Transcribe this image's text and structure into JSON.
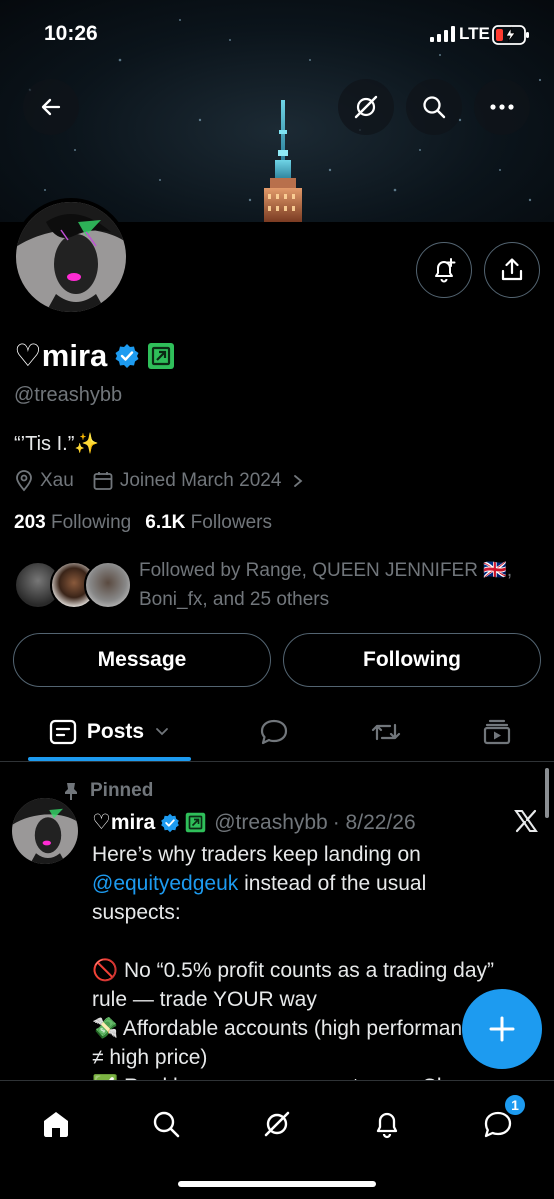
{
  "status": {
    "time": "10:26",
    "network": "LTE"
  },
  "profile": {
    "display_name": "♡mira",
    "handle": "@treashybb",
    "bio": "“’Tis I.”✨",
    "location": "Xau",
    "joined": "Joined March 2024",
    "following_count": "203",
    "following_label": "Following",
    "followers_count": "6.1K",
    "followers_label": "Followers",
    "followed_by_line1": "Followed by Range, QUEEN JENNIFER 🇬🇧,",
    "followed_by_line2": "Boni_fx, and 25 others"
  },
  "actions": {
    "message": "Message",
    "following": "Following"
  },
  "tabs": {
    "posts": "Posts"
  },
  "pinned_post": {
    "pinned_label": "Pinned",
    "author": "♡mira",
    "handle": "@treashybb",
    "date": "· 8/22/26",
    "line1": "Here’s why traders keep landing on",
    "mention": "@equityedgeuk",
    "line2_rest": " instead of the usual",
    "line3": "suspects:",
    "line5": "🚫 No “0.5% profit counts as a trading day”",
    "line6": "rule — trade YOUR way",
    "line7": "💸 Affordable accounts (high performance",
    "line8": "≠ high price)",
    "line9": "✅ Real humans, no support gaps. Clean"
  },
  "nav": {
    "notification_badge": "1"
  },
  "colors": {
    "accent": "#1d9bf0",
    "verified": "#1d9bf0",
    "affiliate_badge": "#2fbf5a",
    "background": "#000000"
  }
}
